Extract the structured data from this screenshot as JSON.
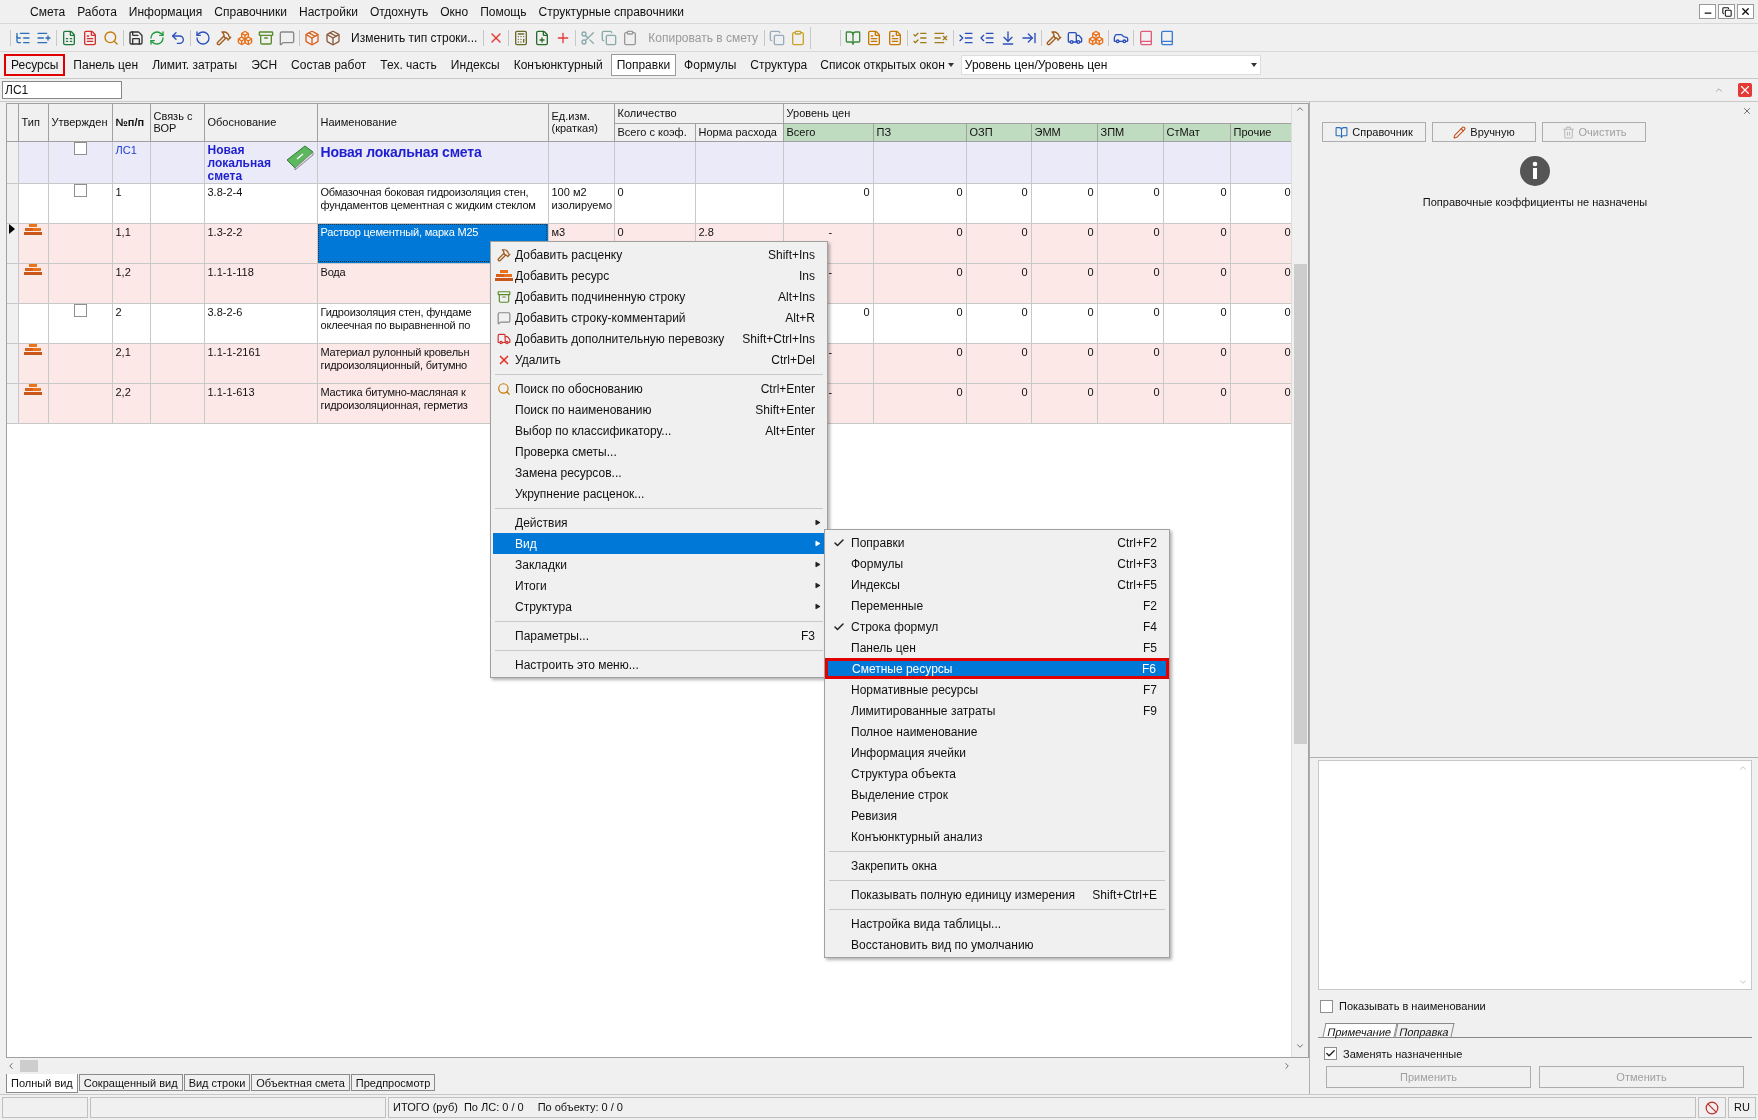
{
  "menu_bar": [
    "Смета",
    "Работа",
    "Информация",
    "Справочники",
    "Настройки",
    "Отдохнуть",
    "Окно",
    "Помощь",
    "Структурные справочники"
  ],
  "toolbar": [
    {
      "label": "Изменить тип строки...",
      "disabled": false
    },
    {
      "label": "Копировать в смету",
      "disabled": true
    }
  ],
  "panel_tabs": [
    {
      "label": "Ресурсы",
      "selected": false,
      "annotated": true
    },
    {
      "label": "Панель цен",
      "selected": false,
      "annotated": false
    },
    {
      "label": "Лимит. затраты",
      "selected": false,
      "annotated": false
    },
    {
      "label": "ЭСН",
      "selected": false,
      "annotated": false
    },
    {
      "label": "Состав работ",
      "selected": false,
      "annotated": false
    },
    {
      "label": "Тех. часть",
      "selected": false,
      "annotated": false
    },
    {
      "label": "Индексы",
      "selected": false,
      "annotated": false
    },
    {
      "label": "Конъюнктурный",
      "selected": false,
      "annotated": false
    },
    {
      "label": "Поправки",
      "selected": true,
      "annotated": false
    },
    {
      "label": "Формулы",
      "selected": false,
      "annotated": false
    },
    {
      "label": "Структура",
      "selected": false,
      "annotated": false
    }
  ],
  "open_windows": "Список открытых окон",
  "price_level": "Уровень цен/Уровень цен",
  "cell_address": "ЛС1",
  "table": {
    "columns": [
      "Тип",
      "Утвержден",
      "№п/п",
      "Связь с ВОР",
      "Обоснование",
      "Наименование",
      "Ед.изм. (краткая)"
    ],
    "quantity_group": {
      "label": "Количество",
      "columns": [
        "Всего с коэф.",
        "Норма расхода"
      ]
    },
    "price_group": {
      "label": "Уровень цен",
      "columns": [
        "Всего",
        "ПЗ",
        "ОЗП",
        "ЭММ",
        "ЗПМ",
        "СтМат",
        "Прочие"
      ]
    },
    "rows": [
      {
        "kind": "estimate",
        "current": false,
        "checked": false,
        "num": "ЛС1",
        "code": "Новая локальная смета",
        "name": [
          "Новая локальная смета"
        ],
        "name_selected": false,
        "prices": []
      },
      {
        "kind": "item",
        "current": false,
        "checked": false,
        "num": "1",
        "code": "3.8-2-4",
        "name": [
          "Обмазочная боковая гидроизоляция стен,",
          "фундаментов цементная с жидким стеклом"
        ],
        "name_selected": false,
        "unit": "100 м2 изолируемо",
        "qty_total": "0",
        "prices": [
          "0",
          "0",
          "0",
          "0",
          "0",
          "0",
          "0"
        ]
      },
      {
        "kind": "resource",
        "current": true,
        "num": "1,1",
        "code": "1.3-2-2",
        "name": [
          "Раствор цементный, марка М25"
        ],
        "name_selected": true,
        "unit": "м3",
        "qty_total": "0",
        "qty_norm": "2.8",
        "prices": [
          "-",
          "0",
          "0",
          "0",
          "0",
          "0",
          "0"
        ]
      },
      {
        "kind": "resource",
        "current": false,
        "num": "1,2",
        "code": "1.1-1-118",
        "name": [
          "Вода"
        ],
        "name_selected": false,
        "prices": [
          "-",
          "0",
          "0",
          "0",
          "0",
          "0",
          "0"
        ]
      },
      {
        "kind": "item",
        "current": false,
        "checked": false,
        "num": "2",
        "code": "3.8-2-6",
        "name": [
          "Гидроизоляция стен, фундаме",
          "оклеечная по выравненной по"
        ],
        "name_selected": false,
        "prices": [
          "0",
          "0",
          "0",
          "0",
          "0",
          "0",
          "0"
        ]
      },
      {
        "kind": "resource",
        "current": false,
        "num": "2,1",
        "code": "1.1-1-2161",
        "name": [
          "Материал рулонный кровельн",
          "гидроизоляционный, битумно"
        ],
        "name_selected": false,
        "prices": [
          "-",
          "0",
          "0",
          "0",
          "0",
          "0",
          "0"
        ]
      },
      {
        "kind": "resource",
        "current": false,
        "num": "2,2",
        "code": "1.1-1-613",
        "name": [
          "Мастика битумно-масляная к",
          "гидроизоляционная, герметиз"
        ],
        "name_selected": false,
        "prices": [
          "-",
          "0",
          "0",
          "0",
          "0",
          "0",
          "0"
        ]
      }
    ]
  },
  "context_menu": [
    {
      "kind": "item",
      "label": "Добавить расценку",
      "shortcut": "Shift+Ins",
      "selected": false,
      "submenu": false
    },
    {
      "kind": "item",
      "label": "Добавить ресурс",
      "shortcut": "Ins",
      "selected": false,
      "submenu": false
    },
    {
      "kind": "item",
      "label": "Добавить подчиненную строку",
      "shortcut": "Alt+Ins",
      "selected": false,
      "submenu": false
    },
    {
      "kind": "item",
      "label": "Добавить строку-комментарий",
      "shortcut": "Alt+R",
      "selected": false,
      "submenu": false
    },
    {
      "kind": "item",
      "label": "Добавить дополнительную перевозку",
      "shortcut": "Shift+Ctrl+Ins",
      "selected": false,
      "submenu": false
    },
    {
      "kind": "item",
      "label": "Удалить",
      "shortcut": "Ctrl+Del",
      "selected": false,
      "submenu": false
    },
    {
      "kind": "separator"
    },
    {
      "kind": "item",
      "label": "Поиск по обоснованию",
      "shortcut": "Ctrl+Enter",
      "selected": false,
      "submenu": false
    },
    {
      "kind": "item",
      "label": "Поиск по наименованию",
      "shortcut": "Shift+Enter",
      "selected": false,
      "submenu": false
    },
    {
      "kind": "item",
      "label": "Выбор по классификатору...",
      "shortcut": "Alt+Enter",
      "selected": false,
      "submenu": false
    },
    {
      "kind": "item",
      "label": "Проверка сметы...",
      "selected": false,
      "submenu": false
    },
    {
      "kind": "item",
      "label": "Замена ресурсов...",
      "selected": false,
      "submenu": false
    },
    {
      "kind": "item",
      "label": "Укрупнение расценок...",
      "selected": false,
      "submenu": false
    },
    {
      "kind": "separator"
    },
    {
      "kind": "item",
      "label": "Действия",
      "selected": false,
      "submenu": true
    },
    {
      "kind": "item",
      "label": "Вид",
      "selected": true,
      "submenu": true
    },
    {
      "kind": "item",
      "label": "Закладки",
      "selected": false,
      "submenu": true
    },
    {
      "kind": "item",
      "label": "Итоги",
      "selected": false,
      "submenu": true
    },
    {
      "kind": "item",
      "label": "Структура",
      "selected": false,
      "submenu": true
    },
    {
      "kind": "separator"
    },
    {
      "kind": "item",
      "label": "Параметры...",
      "shortcut": "F3",
      "selected": false,
      "submenu": false
    },
    {
      "kind": "separator"
    },
    {
      "kind": "item",
      "label": "Настроить это меню...",
      "selected": false,
      "submenu": false
    }
  ],
  "view_submenu": [
    {
      "kind": "item",
      "label": "Поправки",
      "shortcut": "Ctrl+F2",
      "checked": true,
      "selected": false,
      "annotated": false
    },
    {
      "kind": "item",
      "label": "Формулы",
      "shortcut": "Ctrl+F3",
      "checked": false,
      "selected": false,
      "annotated": false
    },
    {
      "kind": "item",
      "label": "Индексы",
      "shortcut": "Ctrl+F5",
      "checked": false,
      "selected": false,
      "annotated": false
    },
    {
      "kind": "item",
      "label": "Переменные",
      "shortcut": "F2",
      "checked": false,
      "selected": false,
      "annotated": false
    },
    {
      "kind": "item",
      "label": "Строка формул",
      "shortcut": "F4",
      "checked": true,
      "selected": false,
      "annotated": false
    },
    {
      "kind": "item",
      "label": "Панель цен",
      "shortcut": "F5",
      "checked": false,
      "selected": false,
      "annotated": false
    },
    {
      "kind": "item",
      "label": "Сметные ресурсы",
      "shortcut": "F6",
      "checked": false,
      "selected": true,
      "annotated": true
    },
    {
      "kind": "item",
      "label": "Нормативные ресурсы",
      "shortcut": "F7",
      "checked": false,
      "selected": false,
      "annotated": false
    },
    {
      "kind": "item",
      "label": "Лимитированные затраты",
      "shortcut": "F9",
      "checked": false,
      "selected": false,
      "annotated": false
    },
    {
      "kind": "item",
      "label": "Полное наименование",
      "checked": false,
      "selected": false,
      "annotated": false
    },
    {
      "kind": "item",
      "label": "Информация ячейки",
      "checked": false,
      "selected": false,
      "annotated": false
    },
    {
      "kind": "item",
      "label": "Структура объекта",
      "checked": false,
      "selected": false,
      "annotated": false
    },
    {
      "kind": "item",
      "label": "Выделение строк",
      "checked": false,
      "selected": false,
      "annotated": false
    },
    {
      "kind": "item",
      "label": "Ревизия",
      "checked": false,
      "selected": false,
      "annotated": false
    },
    {
      "kind": "item",
      "label": "Конъюнктурный анализ",
      "checked": false,
      "selected": false,
      "annotated": false
    },
    {
      "kind": "separator"
    },
    {
      "kind": "item",
      "label": "Закрепить окна",
      "checked": false,
      "selected": false,
      "annotated": false
    },
    {
      "kind": "separator"
    },
    {
      "kind": "item",
      "label": "Показывать полную единицу измерения",
      "shortcut": "Shift+Ctrl+E",
      "checked": false,
      "selected": false,
      "annotated": false
    },
    {
      "kind": "separator"
    },
    {
      "kind": "item",
      "label": "Настройка вида таблицы...",
      "checked": false,
      "selected": false,
      "annotated": false
    },
    {
      "kind": "item",
      "label": "Восстановить вид по умолчанию",
      "checked": false,
      "selected": false,
      "annotated": false
    }
  ],
  "right_panel": {
    "buttons": [
      {
        "label": "Справочник",
        "disabled": false
      },
      {
        "label": "Вручную",
        "disabled": false
      },
      {
        "label": "Очистить",
        "disabled": true
      }
    ],
    "message": "Поправочные коэффициенты не назначены",
    "show_in_name": {
      "label": "Показывать в наименовании",
      "checked": false
    },
    "tabs": [
      {
        "label": "Примечание",
        "selected": true
      },
      {
        "label": "Поправка",
        "selected": false
      }
    ],
    "replace_assigned": {
      "label": "Заменять назначенные",
      "checked": true
    },
    "actions": [
      {
        "label": "Применить",
        "disabled": true
      },
      {
        "label": "Отменить",
        "disabled": true
      }
    ]
  },
  "view_tabs": [
    {
      "label": "Полный вид",
      "selected": true
    },
    {
      "label": "Сокращенный вид",
      "selected": false
    },
    {
      "label": "Вид строки",
      "selected": false
    },
    {
      "label": "Объектная смета",
      "selected": false
    },
    {
      "label": "Предпросмотр",
      "selected": false
    }
  ],
  "status_bar": {
    "total": "ИТОГО (руб)",
    "by_estimate": "По ЛС: 0 / 0",
    "by_object": "По объекту: 0 / 0",
    "language": "RU"
  }
}
